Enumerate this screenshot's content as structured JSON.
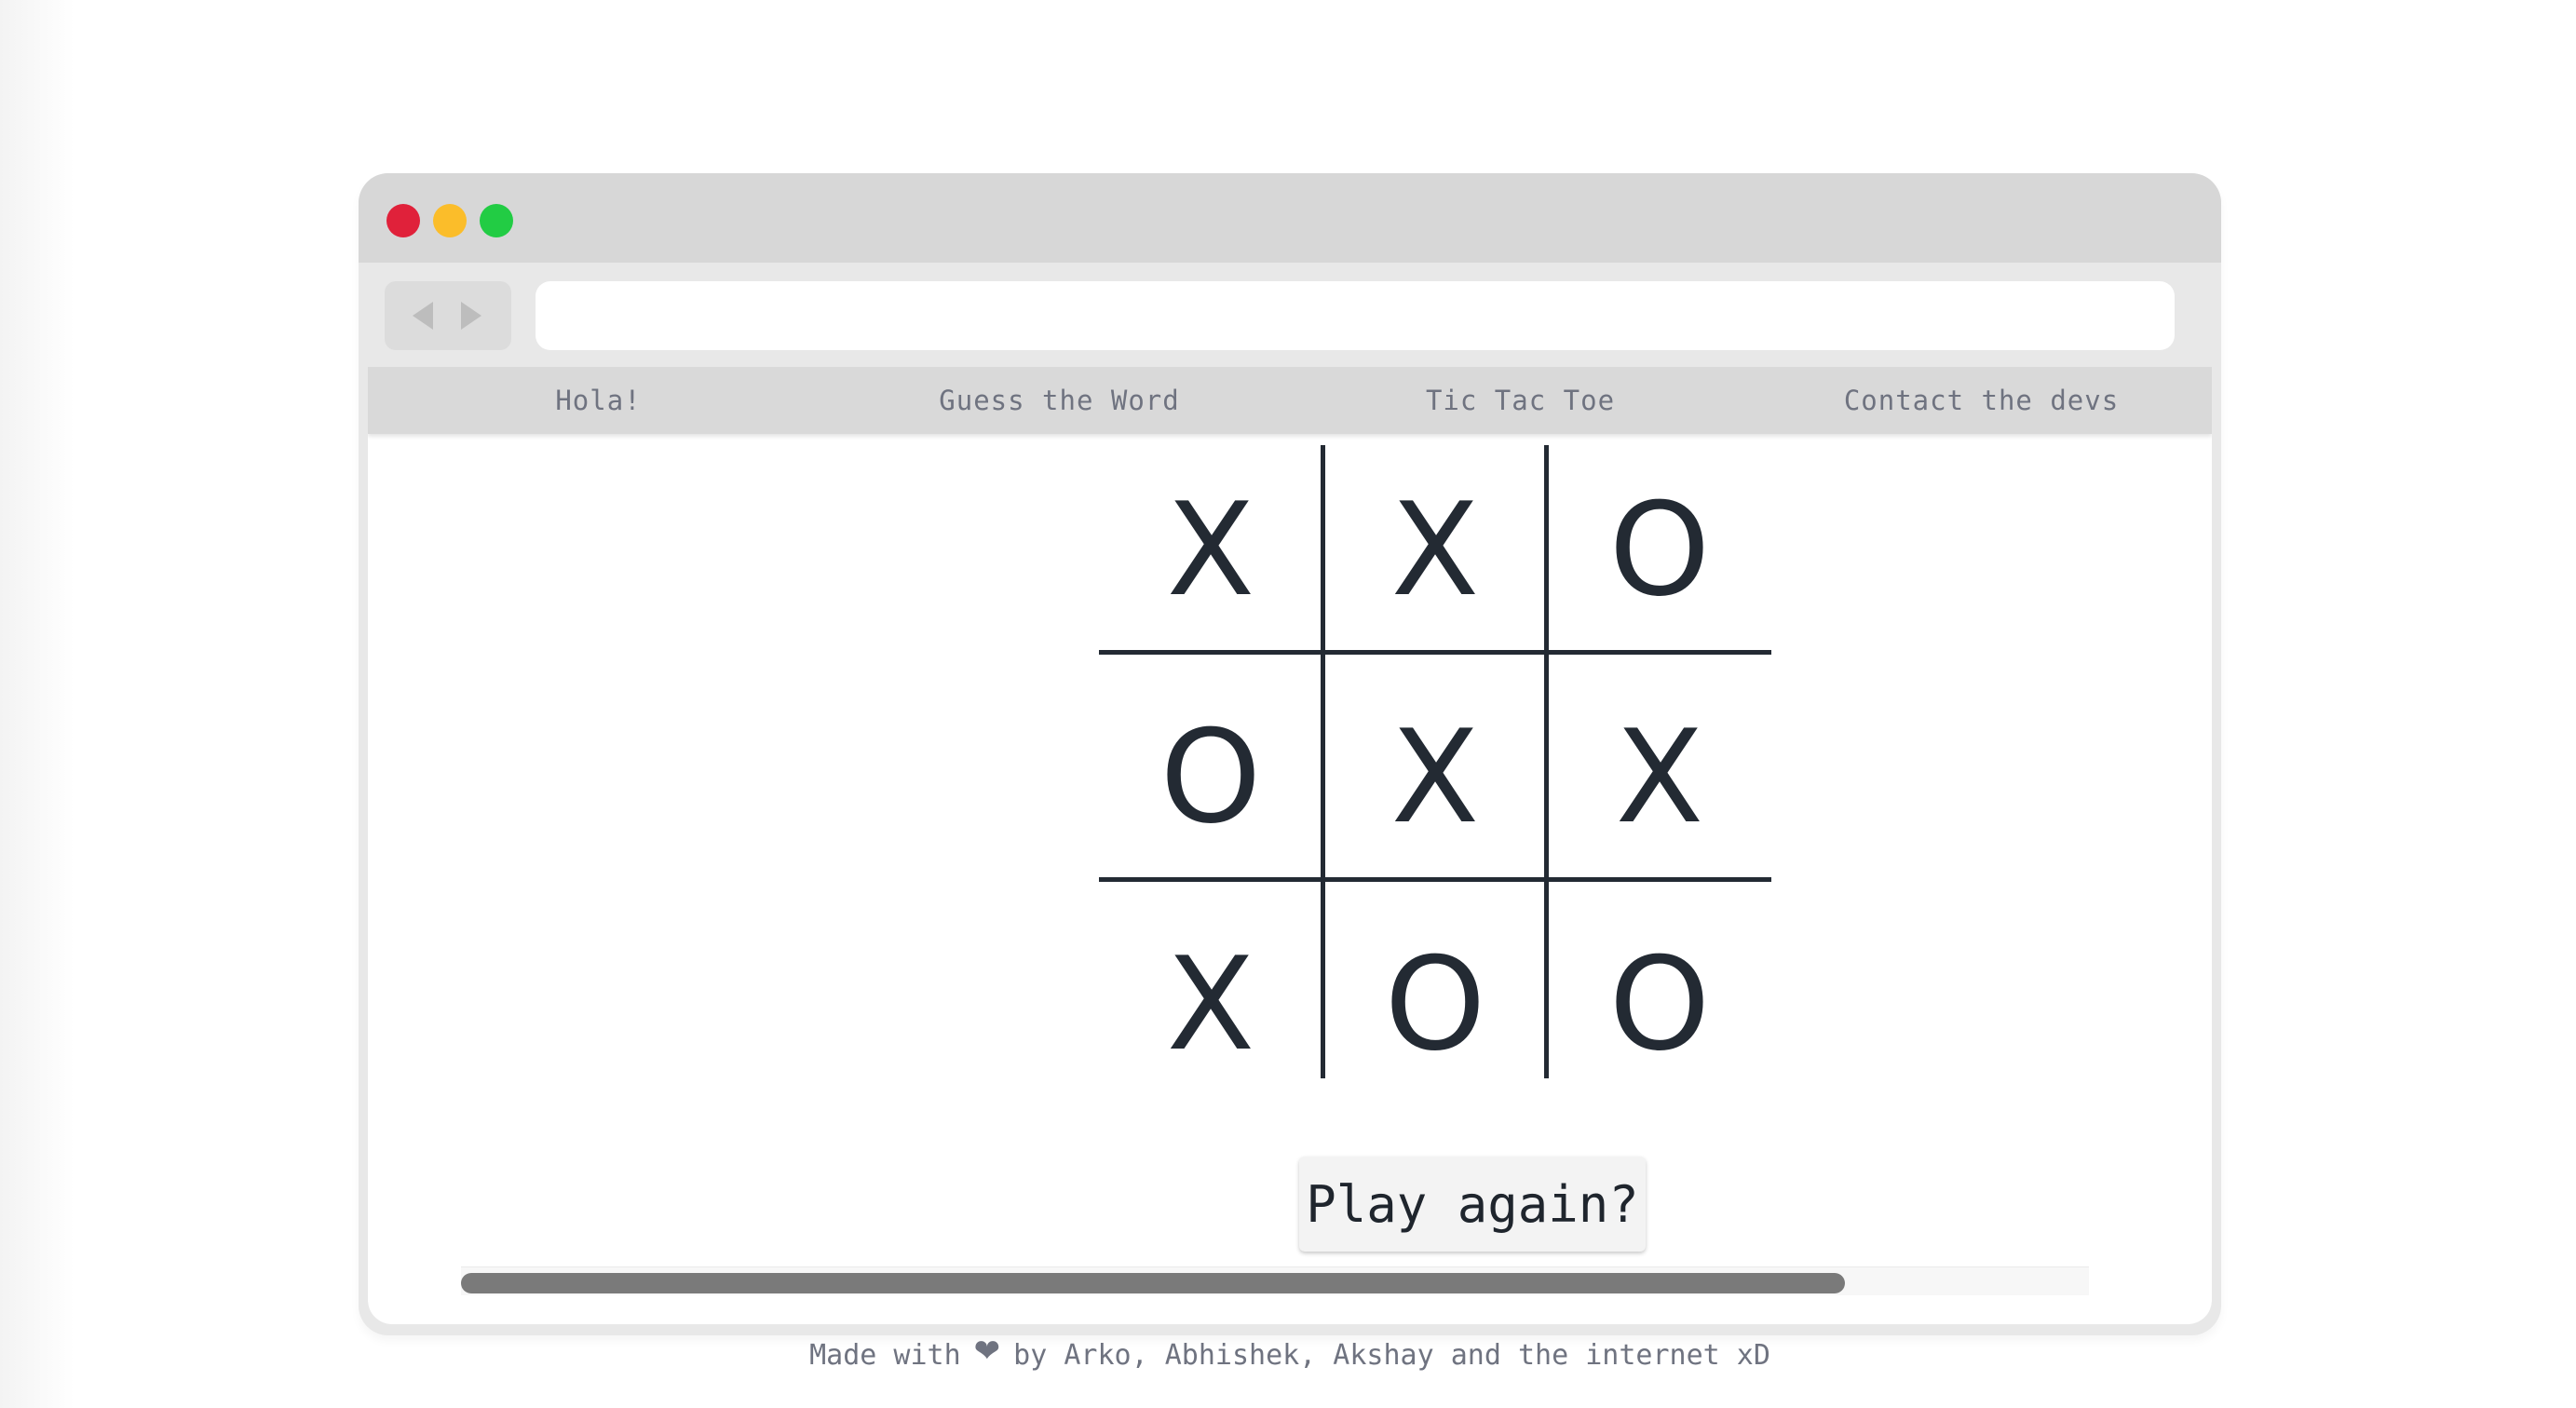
{
  "window": {
    "title_dots": [
      "close",
      "minimize",
      "maximize"
    ],
    "colors": {
      "close": "#e0213a",
      "minimize": "#fbbd2a",
      "maximize": "#22cc44"
    }
  },
  "toolbar": {
    "back_icon": "triangle-left-icon",
    "forward_icon": "triangle-right-icon",
    "address_value": ""
  },
  "navbar": {
    "items": [
      {
        "label": "Hola!"
      },
      {
        "label": "Guess the Word"
      },
      {
        "label": "Tic Tac Toe"
      },
      {
        "label": "Contact the devs"
      }
    ]
  },
  "board": {
    "cells": [
      "X",
      "X",
      "O",
      "O",
      "X",
      "X",
      "X",
      "O",
      "O"
    ]
  },
  "game": {
    "play_again_label": "Play again?"
  },
  "scrollbar": {
    "position_fraction": 0.0,
    "visible_fraction": 0.85
  },
  "footer": {
    "prefix": "Made with",
    "heart_icon": "heart-icon",
    "suffix": "by Arko, Abhishek, Akshay and the internet xD"
  }
}
